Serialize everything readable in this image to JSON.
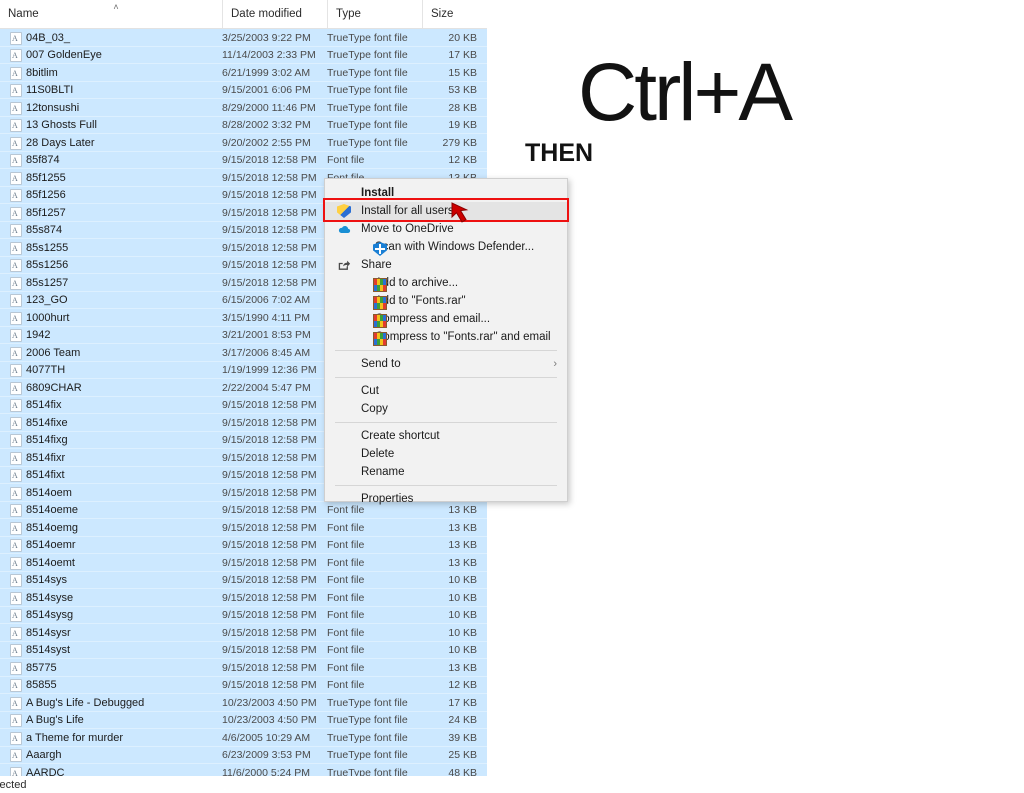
{
  "explorer": {
    "columns": [
      {
        "key": "name",
        "label": "Name"
      },
      {
        "key": "date",
        "label": "Date modified"
      },
      {
        "key": "type",
        "label": "Type"
      },
      {
        "key": "size",
        "label": "Size"
      }
    ],
    "sort_indicator": "˄",
    "status": "elected",
    "selection_color": "#cce8ff",
    "rows": [
      {
        "name": "04B_03_",
        "date": "3/25/2003 9:22 PM",
        "type": "TrueType font file",
        "size": "20 KB"
      },
      {
        "name": "007 GoldenEye",
        "date": "11/14/2003 2:33 PM",
        "type": "TrueType font file",
        "size": "17 KB"
      },
      {
        "name": "8bitlim",
        "date": "6/21/1999 3:02 AM",
        "type": "TrueType font file",
        "size": "15 KB"
      },
      {
        "name": "11S0BLTI",
        "date": "9/15/2001 6:06 PM",
        "type": "TrueType font file",
        "size": "53 KB"
      },
      {
        "name": "12tonsushi",
        "date": "8/29/2000 11:46 PM",
        "type": "TrueType font file",
        "size": "28 KB"
      },
      {
        "name": "13 Ghosts Full",
        "date": "8/28/2002 3:32 PM",
        "type": "TrueType font file",
        "size": "19 KB"
      },
      {
        "name": "28 Days Later",
        "date": "9/20/2002 2:55 PM",
        "type": "TrueType font file",
        "size": "279 KB"
      },
      {
        "name": "85f874",
        "date": "9/15/2018 12:58 PM",
        "type": "Font file",
        "size": "12 KB"
      },
      {
        "name": "85f1255",
        "date": "9/15/2018 12:58 PM",
        "type": "Font file",
        "size": "13 KB"
      },
      {
        "name": "85f1256",
        "date": "9/15/2018 12:58 PM",
        "type": "",
        "size": ""
      },
      {
        "name": "85f1257",
        "date": "9/15/2018 12:58 PM",
        "type": "",
        "size": ""
      },
      {
        "name": "85s874",
        "date": "9/15/2018 12:58 PM",
        "type": "",
        "size": ""
      },
      {
        "name": "85s1255",
        "date": "9/15/2018 12:58 PM",
        "type": "",
        "size": ""
      },
      {
        "name": "85s1256",
        "date": "9/15/2018 12:58 PM",
        "type": "",
        "size": ""
      },
      {
        "name": "85s1257",
        "date": "9/15/2018 12:58 PM",
        "type": "",
        "size": ""
      },
      {
        "name": "123_GO",
        "date": "6/15/2006 7:02 AM",
        "type": "",
        "size": ""
      },
      {
        "name": "1000hurt",
        "date": "3/15/1990 4:11 PM",
        "type": "",
        "size": ""
      },
      {
        "name": "1942",
        "date": "3/21/2001 8:53 PM",
        "type": "",
        "size": ""
      },
      {
        "name": "2006 Team",
        "date": "3/17/2006 8:45 AM",
        "type": "",
        "size": ""
      },
      {
        "name": "4077TH",
        "date": "1/19/1999 12:36 PM",
        "type": "",
        "size": ""
      },
      {
        "name": "6809CHAR",
        "date": "2/22/2004 5:47 PM",
        "type": "",
        "size": ""
      },
      {
        "name": "8514fix",
        "date": "9/15/2018 12:58 PM",
        "type": "",
        "size": ""
      },
      {
        "name": "8514fixe",
        "date": "9/15/2018 12:58 PM",
        "type": "",
        "size": ""
      },
      {
        "name": "8514fixg",
        "date": "9/15/2018 12:58 PM",
        "type": "",
        "size": ""
      },
      {
        "name": "8514fixr",
        "date": "9/15/2018 12:58 PM",
        "type": "",
        "size": ""
      },
      {
        "name": "8514fixt",
        "date": "9/15/2018 12:58 PM",
        "type": "",
        "size": ""
      },
      {
        "name": "8514oem",
        "date": "9/15/2018 12:58 PM",
        "type": "",
        "size": ""
      },
      {
        "name": "8514oeme",
        "date": "9/15/2018 12:58 PM",
        "type": "Font file",
        "size": "13 KB"
      },
      {
        "name": "8514oemg",
        "date": "9/15/2018 12:58 PM",
        "type": "Font file",
        "size": "13 KB"
      },
      {
        "name": "8514oemr",
        "date": "9/15/2018 12:58 PM",
        "type": "Font file",
        "size": "13 KB"
      },
      {
        "name": "8514oemt",
        "date": "9/15/2018 12:58 PM",
        "type": "Font file",
        "size": "13 KB"
      },
      {
        "name": "8514sys",
        "date": "9/15/2018 12:58 PM",
        "type": "Font file",
        "size": "10 KB"
      },
      {
        "name": "8514syse",
        "date": "9/15/2018 12:58 PM",
        "type": "Font file",
        "size": "10 KB"
      },
      {
        "name": "8514sysg",
        "date": "9/15/2018 12:58 PM",
        "type": "Font file",
        "size": "10 KB"
      },
      {
        "name": "8514sysr",
        "date": "9/15/2018 12:58 PM",
        "type": "Font file",
        "size": "10 KB"
      },
      {
        "name": "8514syst",
        "date": "9/15/2018 12:58 PM",
        "type": "Font file",
        "size": "10 KB"
      },
      {
        "name": "85775",
        "date": "9/15/2018 12:58 PM",
        "type": "Font file",
        "size": "13 KB"
      },
      {
        "name": "85855",
        "date": "9/15/2018 12:58 PM",
        "type": "Font file",
        "size": "12 KB"
      },
      {
        "name": "A Bug's Life - Debugged",
        "date": "10/23/2003 4:50 PM",
        "type": "TrueType font file",
        "size": "17 KB"
      },
      {
        "name": "A Bug's Life",
        "date": "10/23/2003 4:50 PM",
        "type": "TrueType font file",
        "size": "24 KB"
      },
      {
        "name": "a Theme for murder",
        "date": "4/6/2005 10:29 AM",
        "type": "TrueType font file",
        "size": "39 KB"
      },
      {
        "name": "Aaargh",
        "date": "6/23/2009 3:53 PM",
        "type": "TrueType font file",
        "size": "25 KB"
      },
      {
        "name": "AARDC__",
        "date": "11/6/2000 5:24 PM",
        "type": "TrueType font file",
        "size": "48 KB"
      }
    ]
  },
  "context_menu": {
    "items": [
      {
        "label": "Install",
        "icon": "",
        "bold": true,
        "highlight": false,
        "submenu": false
      },
      {
        "label": "Install for all users",
        "icon": "uac-shield",
        "bold": false,
        "highlight": true,
        "submenu": false
      },
      {
        "label": "Move to OneDrive",
        "icon": "onedrive-cloud",
        "bold": false,
        "highlight": false,
        "submenu": false
      },
      {
        "label": "Scan with Windows Defender...",
        "icon": "defender-shield",
        "bold": false,
        "highlight": false,
        "submenu": false
      },
      {
        "label": "Share",
        "icon": "share-arrow",
        "bold": false,
        "highlight": false,
        "submenu": false
      },
      {
        "label": "Add to archive...",
        "icon": "winrar-books",
        "bold": false,
        "highlight": false,
        "submenu": false
      },
      {
        "label": "Add to \"Fonts.rar\"",
        "icon": "winrar-books",
        "bold": false,
        "highlight": false,
        "submenu": false
      },
      {
        "label": "Compress and email...",
        "icon": "winrar-books",
        "bold": false,
        "highlight": false,
        "submenu": false
      },
      {
        "label": "Compress to \"Fonts.rar\" and email",
        "icon": "winrar-books",
        "bold": false,
        "highlight": false,
        "submenu": false
      },
      {
        "label": "Send to",
        "icon": "",
        "bold": false,
        "highlight": false,
        "submenu": true
      },
      {
        "label": "Cut",
        "icon": "",
        "bold": false,
        "highlight": false,
        "submenu": false
      },
      {
        "label": "Copy",
        "icon": "",
        "bold": false,
        "highlight": false,
        "submenu": false
      },
      {
        "label": "Create shortcut",
        "icon": "",
        "bold": false,
        "highlight": false,
        "submenu": false
      },
      {
        "label": "Delete",
        "icon": "",
        "bold": false,
        "highlight": false,
        "submenu": false
      },
      {
        "label": "Rename",
        "icon": "",
        "bold": false,
        "highlight": false,
        "submenu": false
      },
      {
        "label": "Properties",
        "icon": "",
        "bold": false,
        "highlight": false,
        "submenu": false
      }
    ],
    "submenu_glyph": "›",
    "highlight_box_color": "#ee1111"
  },
  "annotations": {
    "shortcut": "Ctrl+A",
    "then": "THEN",
    "cursor_color": "#cc0000"
  }
}
